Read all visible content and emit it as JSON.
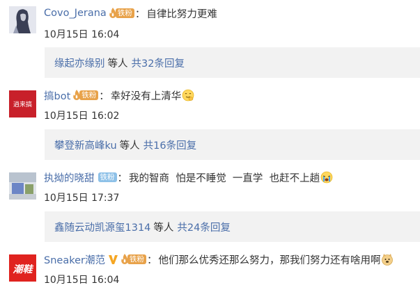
{
  "comments": [
    {
      "username": "Covo_Jerana",
      "badge_label": "铁粉",
      "text": "自律比努力更难",
      "timestamp": "10月15日 16:04",
      "replies": {
        "first_name": "缘起亦缘别",
        "etc": "等人",
        "count": "共32条回复"
      }
    },
    {
      "username": "搞bot",
      "badge_label": "铁粉",
      "text": "幸好没有上清华",
      "timestamp": "10月15日 16:02",
      "avatar_text": "逍来搞",
      "replies": {
        "first_name": "攀登新高峰ku",
        "etc": "等人",
        "count": "共16条回复"
      }
    },
    {
      "username": "执拗的晓甜",
      "badge_label": "铁粉",
      "text": "我的智商  怕是不睡觉  一直学  也赶不上趟",
      "timestamp": "10月15日 17:37",
      "replies": {
        "first_name": "鑫随云动凯源玺1314",
        "etc": "等人",
        "count": "共24条回复"
      }
    },
    {
      "username": "Sneaker潮范",
      "badge_label": "铁粉",
      "text": "他们那么优秀还那么努力，那我们努力还有啥用啊",
      "timestamp": "10月15日 16:04",
      "avatar_text": "潮鞋"
    }
  ],
  "colors": {
    "link": "#4a6ea9",
    "text": "#333333",
    "reply_bg": "#f2f2f2",
    "badge_tan": "#e8a24a",
    "badge_blue": "#8ec1e8",
    "vip_gold": "#f5a623"
  },
  "icons": {
    "fan_badge": "flame-fan-badge-icon",
    "vip": "vip-v-icon",
    "emoji_1": "smirk-hand-emoji-icon",
    "emoji_2": "crying-emoji-icon",
    "emoji_3": "doge-emoji-icon"
  }
}
